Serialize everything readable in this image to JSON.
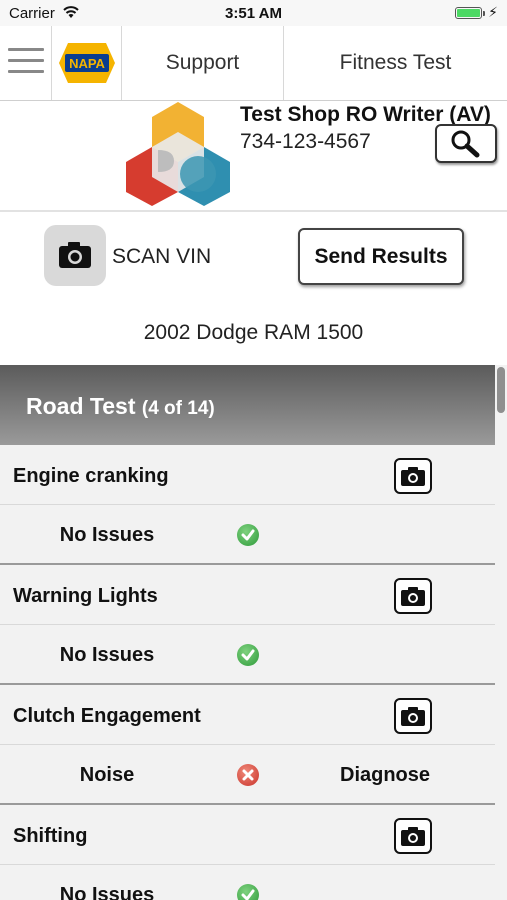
{
  "status_bar": {
    "carrier": "Carrier",
    "time": "3:51 AM"
  },
  "nav": {
    "tabs": [
      {
        "label": "Support"
      },
      {
        "label": "Fitness Test"
      }
    ],
    "logo_text": "NAPA"
  },
  "shop": {
    "name": "Test Shop RO Writer (AV)",
    "phone": "734-123-4567"
  },
  "actions": {
    "scan_vin_label": "SCAN VIN",
    "send_results_label": "Send Results"
  },
  "vehicle": "2002 Dodge RAM 1500",
  "section": {
    "title": "Road Test",
    "count": "(4 of 14)"
  },
  "items": [
    {
      "label": "Engine cranking",
      "status": "No Issues",
      "state": "ok",
      "action": ""
    },
    {
      "label": "Warning Lights",
      "status": "No Issues",
      "state": "ok",
      "action": ""
    },
    {
      "label": "Clutch Engagement",
      "status": "Noise",
      "state": "bad",
      "action": "Diagnose"
    },
    {
      "label": "Shifting",
      "status": "No Issues",
      "state": "ok",
      "action": ""
    }
  ],
  "colors": {
    "ok": "#2e9a3a",
    "bad": "#c8322a",
    "napa_blue": "#0a3d8f",
    "napa_yellow": "#f5b400"
  }
}
